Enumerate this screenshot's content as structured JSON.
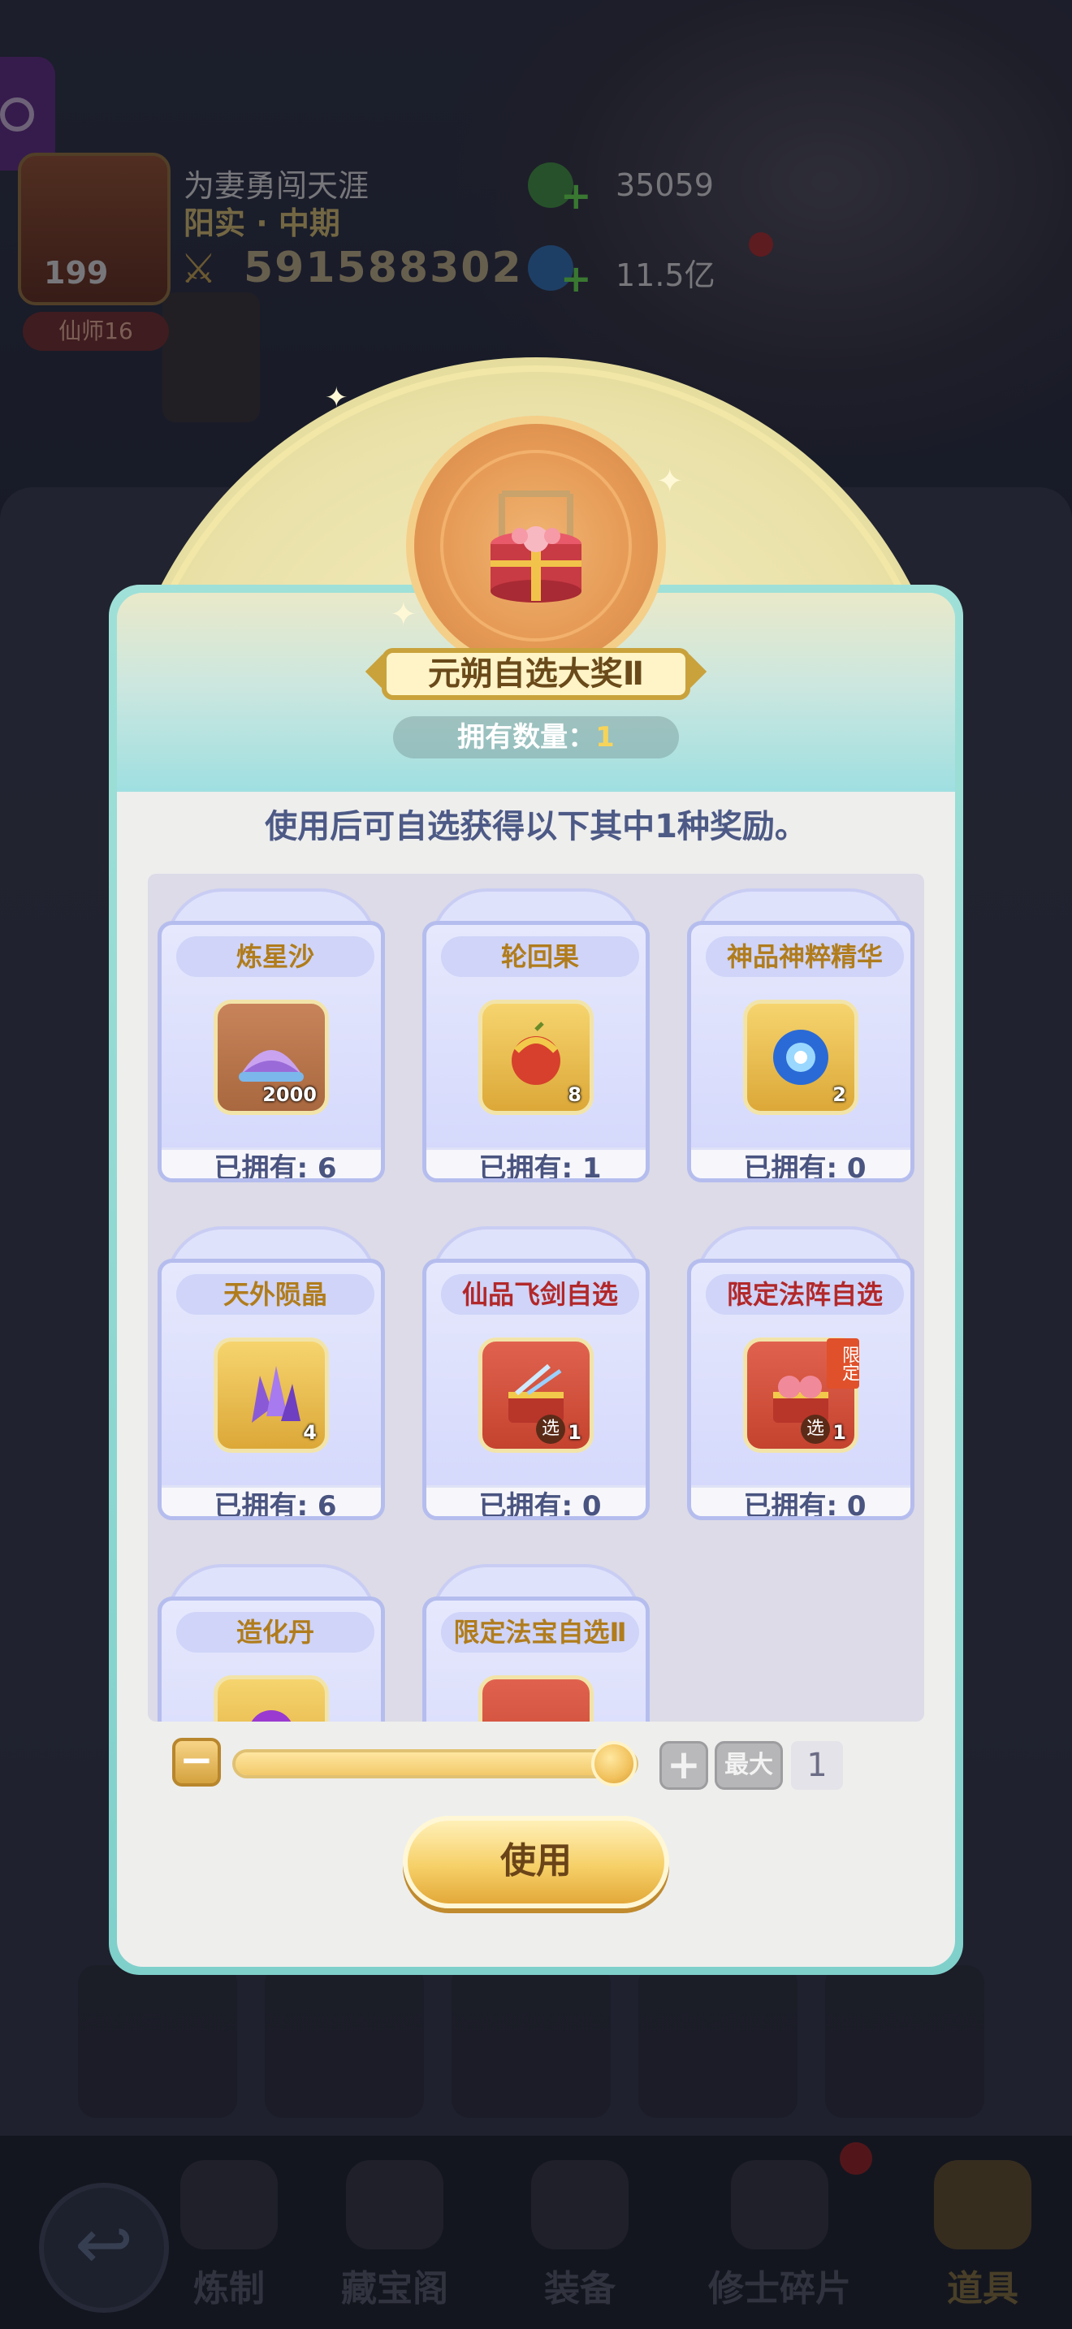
{
  "player": {
    "name": "为妻勇闯天涯",
    "sect": "阳实 · 中期",
    "level": "199",
    "title": "仙师16",
    "power": "591588302"
  },
  "resources": [
    {
      "name": "gem",
      "value": "35059"
    },
    {
      "name": "spirit-stone",
      "value": "11.5亿"
    }
  ],
  "dialog": {
    "title": "元朔自选大奖Ⅱ",
    "owned_label": "拥有数量：",
    "owned_count": "1",
    "description": "使用后可自选获得以下其中1种奖励。",
    "items": [
      {
        "name": "炼星沙",
        "qty": "2000",
        "owned": "已拥有: 6",
        "icon": "star-sand-icon"
      },
      {
        "name": "轮回果",
        "qty": "8",
        "owned": "已拥有: 1",
        "icon": "samsara-fruit-icon"
      },
      {
        "name": "神品神粹精华",
        "qty": "2",
        "owned": "已拥有: 0",
        "icon": "essence-orb-icon"
      },
      {
        "name": "天外陨晶",
        "qty": "4",
        "owned": "已拥有: 6",
        "icon": "meteor-crystal-icon"
      },
      {
        "name": "仙品飞剑自选",
        "qty": "1",
        "badge": "选",
        "owned": "已拥有: 0",
        "icon": "sword-chest-icon"
      },
      {
        "name": "限定法阵自选",
        "qty": "1",
        "badge": "选",
        "tag": "限定",
        "owned": "已拥有: 0",
        "icon": "formation-chest-icon"
      },
      {
        "name": "造化丹",
        "icon": "creation-pill-icon"
      },
      {
        "name": "限定法宝自选Ⅱ",
        "icon": "treasure-chest-icon"
      }
    ],
    "slider": {
      "value": "1",
      "fill_fraction": 1.0,
      "max_label": "最大"
    },
    "use_label": "使用"
  },
  "nav": [
    {
      "label": "炼制"
    },
    {
      "label": "藏宝阁"
    },
    {
      "label": "装备"
    },
    {
      "label": "修士碎片"
    },
    {
      "label": "道具",
      "active": true
    }
  ],
  "colors": {
    "accent_gold": "#f2c96a",
    "text_blue": "#4d5a86",
    "name_red": "#b2282a",
    "name_gold": "#b07c1c"
  }
}
